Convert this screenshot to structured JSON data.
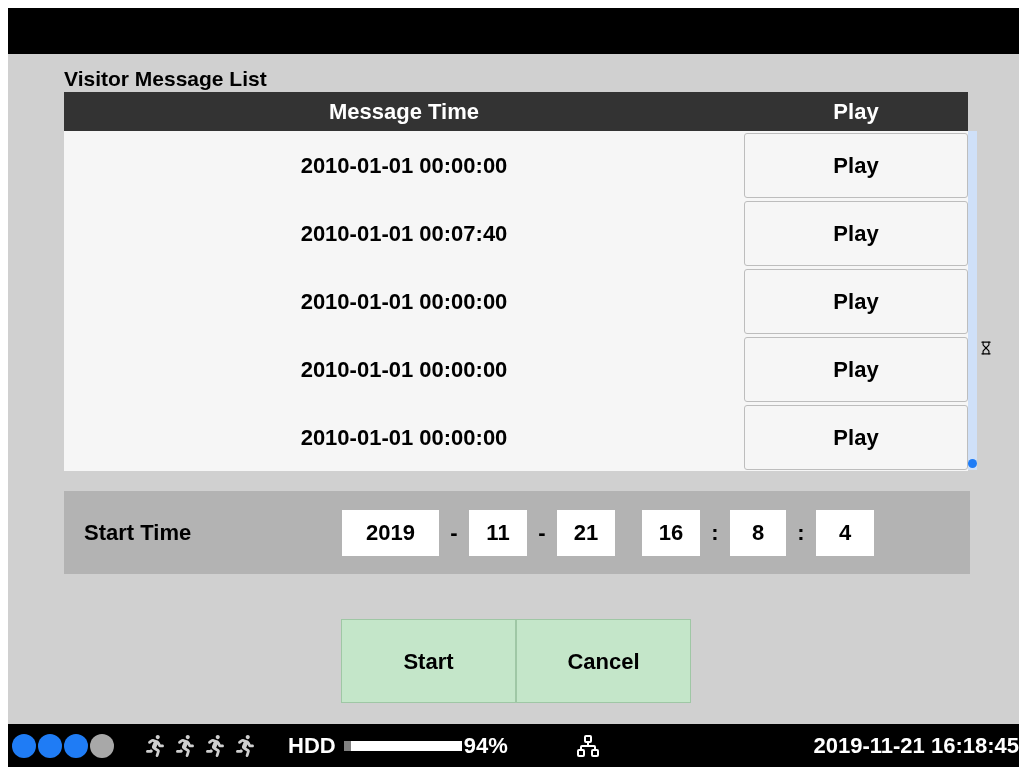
{
  "title": "Visitor Message List",
  "table": {
    "columns": [
      "Message Time",
      "Play"
    ],
    "rows": [
      {
        "time": "2010-01-01 00:00:00",
        "action": "Play"
      },
      {
        "time": "2010-01-01 00:07:40",
        "action": "Play"
      },
      {
        "time": "2010-01-01 00:00:00",
        "action": "Play"
      },
      {
        "time": "2010-01-01 00:00:00",
        "action": "Play"
      },
      {
        "time": "2010-01-01 00:00:00",
        "action": "Play"
      }
    ]
  },
  "start_time": {
    "label": "Start Time",
    "year": "2019",
    "sep1": "-",
    "month": "11",
    "sep2": "-",
    "day": "21",
    "hour": "16",
    "sep3": ":",
    "minute": "8",
    "sep4": ":",
    "second": "4"
  },
  "buttons": [
    "Start",
    "Cancel"
  ],
  "status_bar": {
    "dots": [
      {
        "color": "#1f7cf5"
      },
      {
        "color": "#1f7cf5"
      },
      {
        "color": "#1f7cf5"
      },
      {
        "color": "#a8a8a8"
      }
    ],
    "hdd": {
      "label": "HDD",
      "level": 0.94,
      "reading": "94%"
    },
    "datetime": "2019-11-21 16:18:45"
  }
}
